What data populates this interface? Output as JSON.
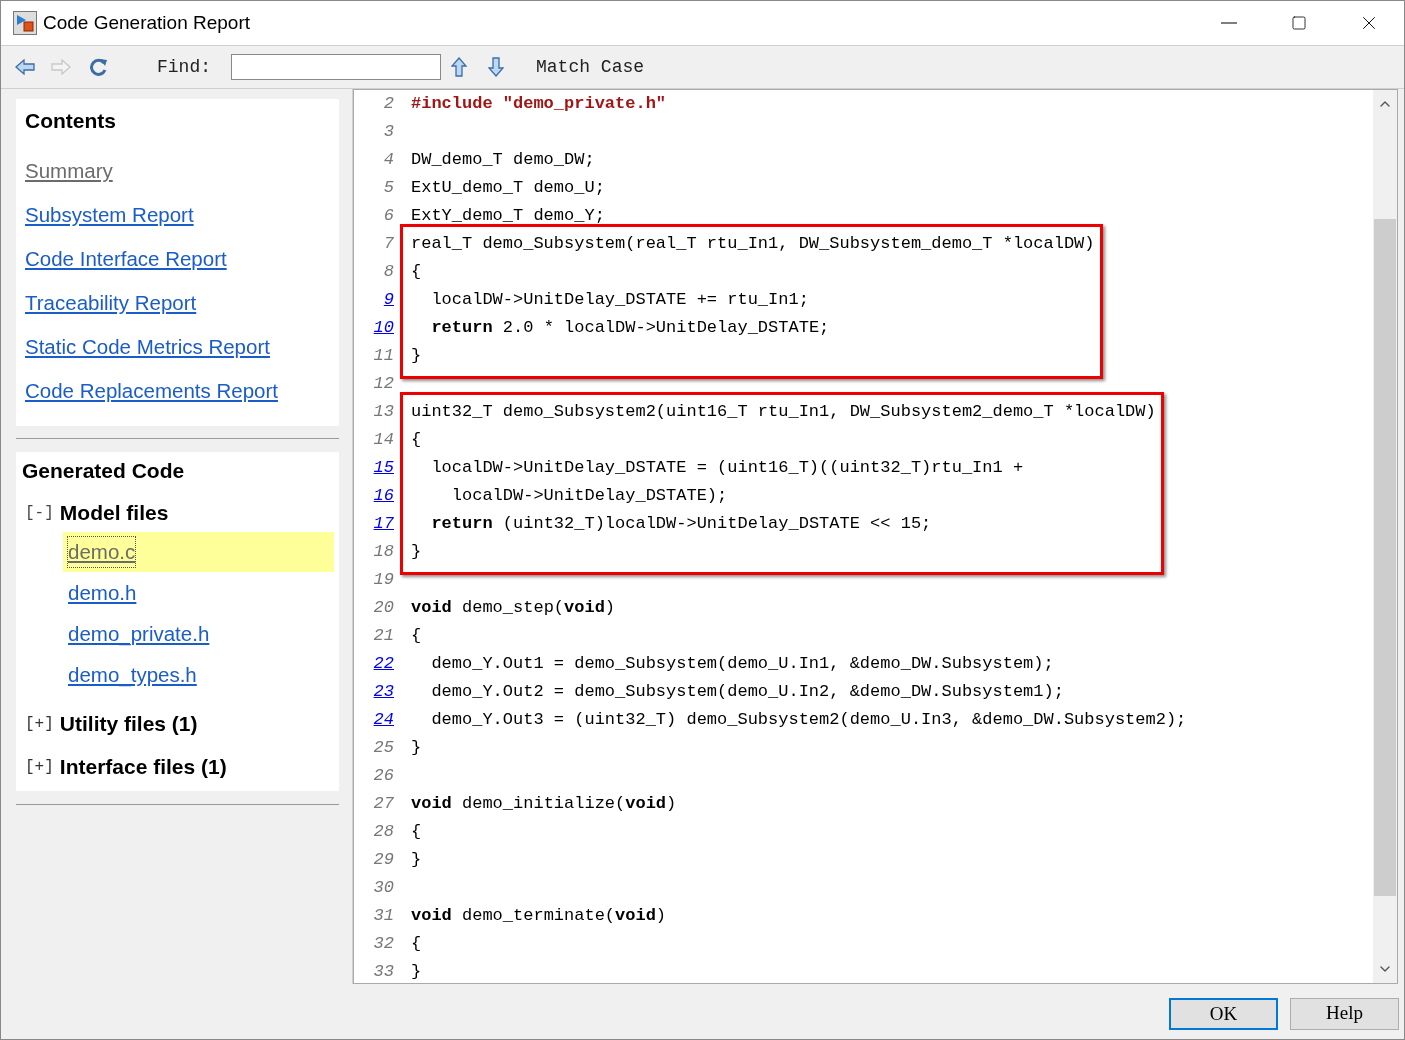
{
  "window": {
    "title": "Code Generation Report"
  },
  "toolbar": {
    "find_label": "Find:",
    "match_case": "Match Case"
  },
  "contents": {
    "title": "Contents",
    "links": [
      {
        "label": "Summary",
        "visited": true
      },
      {
        "label": "Subsystem Report",
        "visited": false
      },
      {
        "label": "Code Interface Report",
        "visited": false
      },
      {
        "label": "Traceability Report",
        "visited": false
      },
      {
        "label": "Static Code Metrics Report",
        "visited": false
      },
      {
        "label": "Code Replacements Report",
        "visited": false
      }
    ]
  },
  "generated_code": {
    "title": "Generated Code",
    "groups": [
      {
        "toggle": "[-]",
        "label": "Model files",
        "expanded": true,
        "files": [
          {
            "name": "demo.c",
            "selected": true
          },
          {
            "name": "demo.h",
            "selected": false
          },
          {
            "name": "demo_private.h",
            "selected": false
          },
          {
            "name": "demo_types.h",
            "selected": false
          }
        ]
      },
      {
        "toggle": "[+]",
        "label": "Utility files (1)",
        "expanded": false
      },
      {
        "toggle": "[+]",
        "label": "Interface files (1)",
        "expanded": false
      }
    ]
  },
  "code": {
    "blocks": [
      {
        "highlighted": false,
        "lines": [
          {
            "n": "2",
            "link": false,
            "segs": [
              {
                "text": "#include \"demo_private.h\"",
                "kind": "directive"
              }
            ]
          },
          {
            "n": "3",
            "link": false
          },
          {
            "n": "4",
            "link": false,
            "segs": [
              {
                "text": "DW_demo_T demo_DW;",
                "kind": "plain"
              }
            ]
          },
          {
            "n": "5",
            "link": false,
            "segs": [
              {
                "text": "ExtU_demo_T demo_U;",
                "kind": "plain"
              }
            ]
          },
          {
            "n": "6",
            "link": false,
            "segs": [
              {
                "text": "ExtY_demo_T demo_Y;",
                "kind": "plain"
              }
            ]
          }
        ]
      },
      {
        "highlighted": true,
        "lines": [
          {
            "n": "7",
            "link": false,
            "segs": [
              {
                "text": "real_T demo_Subsystem(real_T rtu_In1, DW_Subsystem_demo_T *localDW)",
                "kind": "plain"
              }
            ]
          },
          {
            "n": "8",
            "link": false,
            "segs": [
              {
                "text": "{",
                "kind": "plain"
              }
            ]
          },
          {
            "n": "9",
            "link": true,
            "segs": [
              {
                "text": "  localDW->UnitDelay_DSTATE += rtu_In1;",
                "kind": "plain"
              }
            ]
          },
          {
            "n": "10",
            "link": true,
            "segs": [
              {
                "text": "  return",
                "kind": "keyword"
              },
              {
                "text": " 2.0 * localDW->UnitDelay_DSTATE;",
                "kind": "plain"
              }
            ]
          },
          {
            "n": "11",
            "link": false,
            "segs": [
              {
                "text": "}",
                "kind": "plain"
              }
            ]
          }
        ]
      },
      {
        "highlighted": false,
        "lines": [
          {
            "n": "12",
            "link": false
          }
        ]
      },
      {
        "highlighted": true,
        "lines": [
          {
            "n": "13",
            "link": false,
            "segs": [
              {
                "text": "uint32_T demo_Subsystem2(uint16_T rtu_In1, DW_Subsystem2_demo_T *localDW)",
                "kind": "plain"
              }
            ]
          },
          {
            "n": "14",
            "link": false,
            "segs": [
              {
                "text": "{",
                "kind": "plain"
              }
            ]
          },
          {
            "n": "15",
            "link": true,
            "segs": [
              {
                "text": "  localDW->UnitDelay_DSTATE = (uint16_T)((uint32_T)rtu_In1 +",
                "kind": "plain"
              }
            ]
          },
          {
            "n": "16",
            "link": true,
            "segs": [
              {
                "text": "    localDW->UnitDelay_DSTATE);",
                "kind": "plain"
              }
            ]
          },
          {
            "n": "17",
            "link": true,
            "segs": [
              {
                "text": "  return",
                "kind": "keyword"
              },
              {
                "text": " (uint32_T)localDW->UnitDelay_DSTATE << 15;",
                "kind": "plain"
              }
            ]
          },
          {
            "n": "18",
            "link": false,
            "segs": [
              {
                "text": "}",
                "kind": "plain"
              }
            ]
          }
        ]
      },
      {
        "highlighted": false,
        "lines": [
          {
            "n": "19",
            "link": false
          },
          {
            "n": "20",
            "link": false,
            "segs": [
              {
                "text": "void",
                "kind": "keyword"
              },
              {
                "text": " demo_step(",
                "kind": "plain"
              },
              {
                "text": "void",
                "kind": "keyword"
              },
              {
                "text": ")",
                "kind": "plain"
              }
            ]
          },
          {
            "n": "21",
            "link": false,
            "segs": [
              {
                "text": "{",
                "kind": "plain"
              }
            ]
          },
          {
            "n": "22",
            "link": true,
            "segs": [
              {
                "text": "  demo_Y.Out1 = demo_Subsystem(demo_U.In1, &demo_DW.Subsystem);",
                "kind": "plain"
              }
            ]
          },
          {
            "n": "23",
            "link": true,
            "segs": [
              {
                "text": "  demo_Y.Out2 = demo_Subsystem(demo_U.In2, &demo_DW.Subsystem1);",
                "kind": "plain"
              }
            ]
          },
          {
            "n": "24",
            "link": true,
            "segs": [
              {
                "text": "  demo_Y.Out3 = (uint32_T) demo_Subsystem2(demo_U.In3, &demo_DW.Subsystem2);",
                "kind": "plain"
              }
            ]
          },
          {
            "n": "25",
            "link": false,
            "segs": [
              {
                "text": "}",
                "kind": "plain"
              }
            ]
          },
          {
            "n": "26",
            "link": false
          },
          {
            "n": "27",
            "link": false,
            "segs": [
              {
                "text": "void",
                "kind": "keyword"
              },
              {
                "text": " demo_initialize(",
                "kind": "plain"
              },
              {
                "text": "void",
                "kind": "keyword"
              },
              {
                "text": ")",
                "kind": "plain"
              }
            ]
          },
          {
            "n": "28",
            "link": false,
            "segs": [
              {
                "text": "{",
                "kind": "plain"
              }
            ]
          },
          {
            "n": "29",
            "link": false,
            "segs": [
              {
                "text": "}",
                "kind": "plain"
              }
            ]
          },
          {
            "n": "30",
            "link": false
          },
          {
            "n": "31",
            "link": false,
            "segs": [
              {
                "text": "void",
                "kind": "keyword"
              },
              {
                "text": " demo_terminate(",
                "kind": "plain"
              },
              {
                "text": "void",
                "kind": "keyword"
              },
              {
                "text": ")",
                "kind": "plain"
              }
            ]
          },
          {
            "n": "32",
            "link": false,
            "segs": [
              {
                "text": "{",
                "kind": "plain"
              }
            ]
          },
          {
            "n": "33",
            "link": false,
            "segs": [
              {
                "text": "}",
                "kind": "plain"
              }
            ]
          }
        ]
      }
    ]
  },
  "buttons": [
    {
      "label": "OK",
      "default": true
    },
    {
      "label": "Help",
      "default": false
    }
  ]
}
